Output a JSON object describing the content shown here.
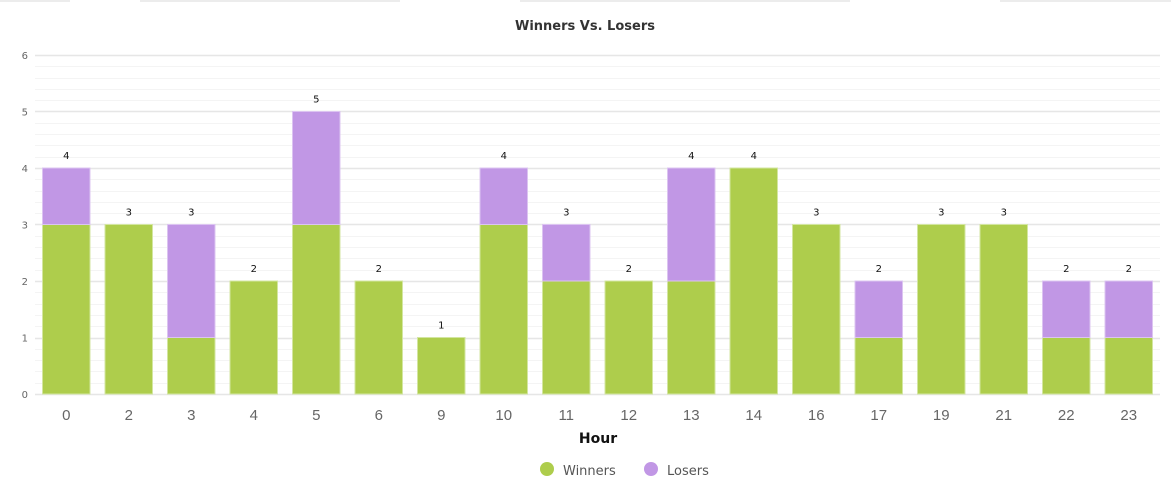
{
  "chart_data": {
    "type": "bar",
    "stacked": true,
    "title": "Winners Vs. Losers",
    "xlabel": "Hour",
    "ylabel": "",
    "categories": [
      "0",
      "2",
      "3",
      "4",
      "5",
      "6",
      "9",
      "10",
      "11",
      "12",
      "13",
      "14",
      "16",
      "17",
      "19",
      "21",
      "22",
      "23"
    ],
    "series": [
      {
        "name": "Winners",
        "color": "#aecd4c",
        "values": [
          3,
          3,
          1,
          2,
          3,
          2,
          1,
          3,
          2,
          2,
          2,
          4,
          3,
          1,
          3,
          3,
          1,
          1
        ]
      },
      {
        "name": "Losers",
        "color": "#c197e5",
        "values": [
          1,
          0,
          2,
          0,
          2,
          0,
          0,
          1,
          1,
          0,
          2,
          0,
          0,
          1,
          0,
          0,
          1,
          1
        ]
      }
    ],
    "totals": [
      4,
      3,
      3,
      2,
      5,
      2,
      1,
      4,
      3,
      2,
      4,
      4,
      3,
      2,
      3,
      3,
      2,
      2
    ],
    "ylim": [
      0,
      6
    ],
    "yticks": [
      "0",
      "1",
      "2",
      "3",
      "4",
      "5",
      "6"
    ],
    "grid": true,
    "minor_grid": true,
    "legend_position": "bottom-center"
  }
}
